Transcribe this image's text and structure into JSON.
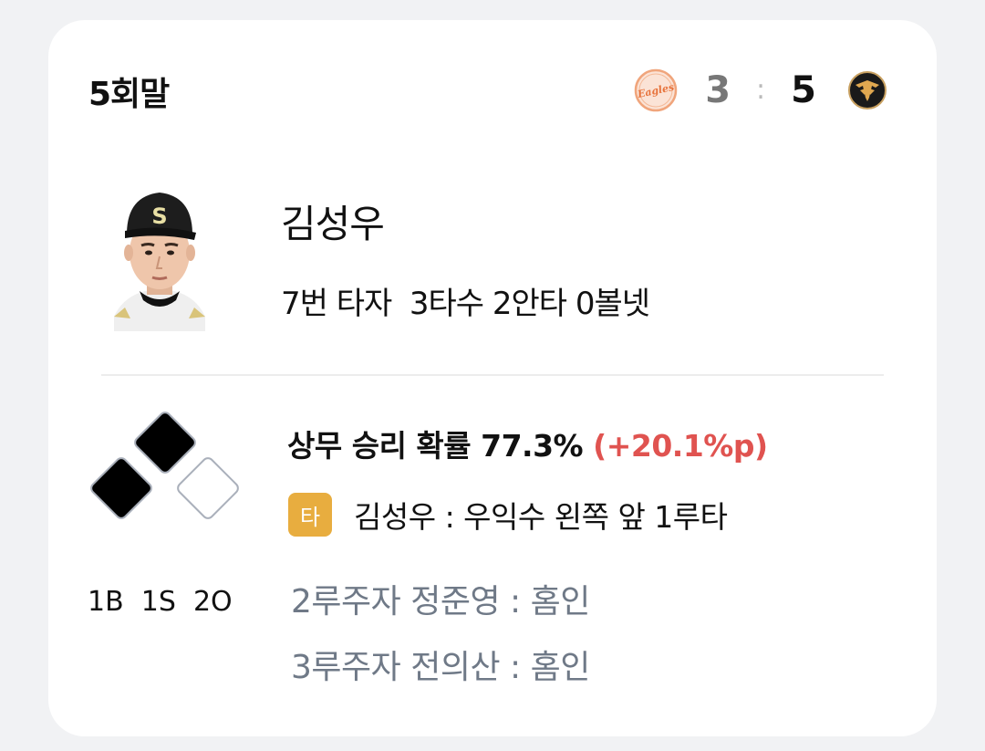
{
  "header": {
    "inning": "5회말"
  },
  "scoreboard": {
    "away_logo_icon": "eagles-logo-icon",
    "away_logo_text": "Eagles",
    "away_score": "3",
    "separator": ":",
    "home_score": "5",
    "home_logo_icon": "tigers-logo-icon"
  },
  "batter": {
    "name": "김성우",
    "stats": "7번 타자  3타수 2안타 0볼넷"
  },
  "situation": {
    "count": "1B  1S  2O",
    "bases": {
      "first": false,
      "second": true,
      "third": true
    }
  },
  "win_probability": {
    "text": "상무 승리 확률 77.3%",
    "delta": "(+20.1%p)"
  },
  "play": {
    "badge": "타",
    "description": "김성우 : 우익수 왼쪽 앞 1루타"
  },
  "runners": [
    "2루주자 정준영 : 홈인",
    "3루주자 전의산 : 홈인"
  ],
  "colors": {
    "delta_red": "#e05350",
    "badge_gold": "#e8ad3f",
    "runner_gray": "#6f7987",
    "base_filled": "#000000",
    "base_border": "#aab0bb"
  }
}
